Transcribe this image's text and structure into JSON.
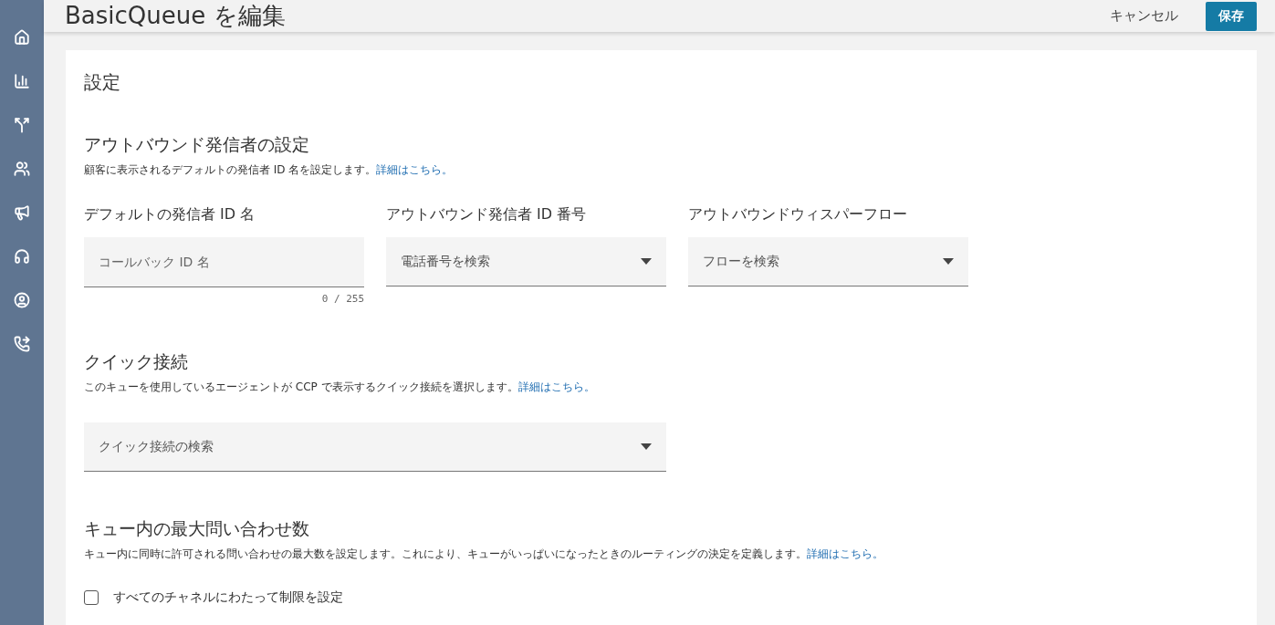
{
  "header": {
    "title": "BasicQueue を編集",
    "cancel": "キャンセル",
    "save": "保存"
  },
  "card": {
    "title": "設定",
    "sections": [
      {
        "heading": "アウトバウンド発信者の設定",
        "description": "顧客に表示されるデフォルトの発信者 ID 名を設定します。",
        "link": "詳細はこちら。",
        "fields": [
          {
            "kind": "text",
            "label": "デフォルトの発信者 ID 名",
            "placeholder": "コールバック ID 名",
            "counter": "0 / 255"
          },
          {
            "kind": "select",
            "label": "アウトバウンド発信者 ID 番号",
            "placeholder": "電話番号を検索"
          },
          {
            "kind": "select",
            "label": "アウトバウンドウィスパーフロー",
            "placeholder": "フローを検索"
          }
        ]
      },
      {
        "heading": "クイック接続",
        "description": "このキューを使用しているエージェントが CCP で表示するクイック接続を選択します。",
        "link": "詳細はこちら。",
        "fields": [
          {
            "kind": "wideselect",
            "placeholder": "クイック接続の検索"
          }
        ]
      },
      {
        "heading": "キュー内の最大問い合わせ数",
        "description": "キュー内に同時に許可される問い合わせの最大数を設定します。これにより、キューがいっぱいになったときのルーティングの決定を定義します。",
        "link": "詳細はこちら。",
        "fields": [
          {
            "kind": "checkbox",
            "label": "すべてのチャネルにわたって制限を設定",
            "checked": false
          }
        ]
      }
    ]
  }
}
